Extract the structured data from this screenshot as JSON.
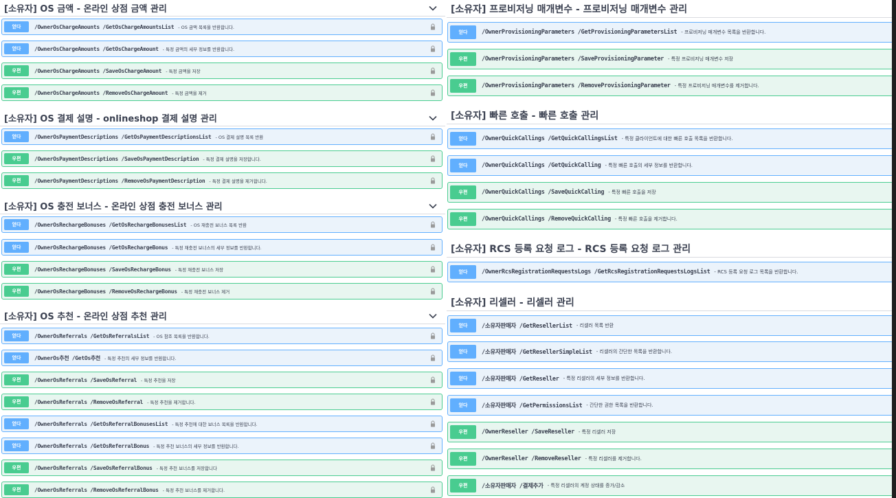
{
  "left": {
    "sections": [
      {
        "title": "[소유자] OS 금액 - 온라인 상점 금액 관리",
        "operations": [
          {
            "method": "GET",
            "method_label": "얻다",
            "path": "/OwnerOsChargeAmounts /GetOsChargeAmountsList",
            "desc": "- OS 금액 목록을 반환합니다."
          },
          {
            "method": "GET",
            "method_label": "얻다",
            "path": "/OwnerOsChargeAmounts /GetOsChargeAmount",
            "desc": "- 특정 금액의 세부 정보를 반환합니다."
          },
          {
            "method": "POST",
            "method_label": "우편",
            "path": "/OwnerOsChargeAmounts /SaveOsChargeAmount",
            "desc": "- 특정 금액을 저장"
          },
          {
            "method": "POST",
            "method_label": "우편",
            "path": "/OwnerOsChargeAmounts /RemoveOsChargeAmount",
            "desc": "- 특정 금액을 제거"
          }
        ]
      },
      {
        "title": "[소유자] OS 결제 설명 - onlineshop 결제 설명 관리",
        "operations": [
          {
            "method": "GET",
            "method_label": "얻다",
            "path": "/OwnerOsPaymentDescriptions /GetOsPaymentDescriptionsList",
            "desc": "- OS 결제 설명 목록 반환"
          },
          {
            "method": "POST",
            "method_label": "우편",
            "path": "/OwnerOsPaymentDescriptions /SaveOsPaymentDescription",
            "desc": "- 특정 결제 설명을 저장합니다."
          },
          {
            "method": "POST",
            "method_label": "우편",
            "path": "/OwnerOsPaymentDescriptions /RemoveOsPaymentDescription",
            "desc": "- 특정 결제 설명을 제거합니다."
          }
        ]
      },
      {
        "title": "[소유자] OS 충전 보너스 - 온라인 상점 충전 보너스 관리",
        "operations": [
          {
            "method": "GET",
            "method_label": "얻다",
            "path": "/OwnerOsRechargeBonuses /GetOsRechargeBonusesList",
            "desc": "- OS 재충전 보너스 목록 반환"
          },
          {
            "method": "GET",
            "method_label": "얻다",
            "path": "/OwnerOsRechargeBonuses /GetOsRechargeBonus",
            "desc": "- 특정 재충전 보너스의 세부 정보를 반환합니다."
          },
          {
            "method": "POST",
            "method_label": "우편",
            "path": "/OwnerOsRechargeBonuses /SaveOsRechargeBonus",
            "desc": "- 특정 재충전 보너스 저장"
          },
          {
            "method": "POST",
            "method_label": "우편",
            "path": "/OwnerOsRechargeBonuses /RemoveOsRechargeBonus",
            "desc": "- 특정 재충전 보너스 제거"
          }
        ]
      },
      {
        "title": "[소유자] OS 추천 - 온라인 상점 추천 관리",
        "operations": [
          {
            "method": "GET",
            "method_label": "얻다",
            "path": "/OwnerOsReferrals /GetOsReferralsList",
            "desc": "- OS 참조 목록을 반환합니다."
          },
          {
            "method": "GET",
            "method_label": "얻다",
            "path": "/OwnerOs추천 /GetOs추천",
            "desc": "- 특정 추천의 세부 정보를 반환합니다."
          },
          {
            "method": "POST",
            "method_label": "우편",
            "path": "/OwnerOsReferrals /SaveOsReferral",
            "desc": "- 특정 추천을 저장"
          },
          {
            "method": "POST",
            "method_label": "우편",
            "path": "/OwnerOsReferrals /RemoveOsReferral",
            "desc": "- 특정 추천을 제거합니다."
          },
          {
            "method": "GET",
            "method_label": "얻다",
            "path": "/OwnerOsReferrals /GetOsReferralBonusesList",
            "desc": "- 특정 추천에 대한 보너스 목록을 반환합니다."
          },
          {
            "method": "GET",
            "method_label": "얻다",
            "path": "/OwnerOsReferrals /GetOsReferralBonus",
            "desc": "- 특정 추천 보너스의 세부 정보를 반환합니다."
          },
          {
            "method": "POST",
            "method_label": "우편",
            "path": "/OwnerOsReferrals /SaveOsReferralBonus",
            "desc": "- 특정 추천 보너스를 저장합니다"
          },
          {
            "method": "POST",
            "method_label": "우편",
            "path": "/OwnerOsReferrals /RemoveOsReferralBonus",
            "desc": "- 특정 추천 보너스를 제거합니다."
          }
        ]
      }
    ]
  },
  "right": {
    "sections": [
      {
        "title": "[소유자] 프로비저닝 매개변수 - 프로비저닝 매개변수 관리",
        "operations": [
          {
            "method": "GET",
            "method_label": "얻다",
            "path": "/OwnerProvisioningParameters /GetProvisioningParametersList",
            "desc": "- 프로비저닝 매개변수 목록을 반환합니다."
          },
          {
            "method": "POST",
            "method_label": "우편",
            "path": "/OwnerProvisioningParameters /SaveProvisioningParameter",
            "desc": "- 특정 프로비저닝 매개변수 저장"
          },
          {
            "method": "POST",
            "method_label": "우편",
            "path": "/OwnerProvisioningParameters /RemoveProvisioningParameter",
            "desc": "- 특정 프로비저닝 매개변수를 제거합니다."
          }
        ]
      },
      {
        "title": "[소유자] 빠른 호출 - 빠른 호출 관리",
        "operations": [
          {
            "method": "GET",
            "method_label": "얻다",
            "path": "/OwnerQuickCallings /GetQuickCallingsList",
            "desc": "- 특정 클라이언트에 대한 빠른 호출 목록을 반환합니다."
          },
          {
            "method": "GET",
            "method_label": "얻다",
            "path": "/OwnerQuickCallings /GetQuickCalling",
            "desc": "- 특정 빠른 호출의 세부 정보를 반환합니다."
          },
          {
            "method": "POST",
            "method_label": "우편",
            "path": "/OwnerQuickCallings /SaveQuickCalling",
            "desc": "- 특정 빠른 호출을 저장"
          },
          {
            "method": "POST",
            "method_label": "우편",
            "path": "/OwnerQuickCallings /RemoveQuickCalling",
            "desc": "- 특정 빠른 호출을 제거합니다."
          }
        ]
      },
      {
        "title": "[소유자] RCS 등록 요청 로그 - RCS 등록 요청 로그 관리",
        "operations": [
          {
            "method": "GET",
            "method_label": "얻다",
            "path": "/OwnerRcsRegistrationRequestsLogs /GetRcsRegistrationRequestsLogsList",
            "desc": "- RCS 등록 요청 로그 목록을 반환합니다."
          }
        ]
      },
      {
        "title": "[소유자] 리셀러 - 리셀러 관리",
        "operations": [
          {
            "method": "GET",
            "method_label": "얻다",
            "path": "/소유자판매자 /GetResellerList",
            "desc": "- 리셀러 목록 반환"
          },
          {
            "method": "GET",
            "method_label": "얻다",
            "path": "/소유자판매자 /GetResellerSimpleList",
            "desc": "- 리셀러의 간단한 목록을 반환합니다."
          },
          {
            "method": "GET",
            "method_label": "얻다",
            "path": "/소유자판매자 /GetReseller",
            "desc": "- 특정 리셀러의 세부 정보를 반환합니다."
          },
          {
            "method": "GET",
            "method_label": "얻다",
            "path": "/소유자판매자 /GetPermissionsList",
            "desc": "- 간단한 권한 목록을 반환합니다."
          },
          {
            "method": "POST",
            "method_label": "우편",
            "path": "/OwnerReseller /SaveReseller",
            "desc": "- 특정 리셀러 저장"
          },
          {
            "method": "POST",
            "method_label": "우편",
            "path": "/OwnerReseller /RemoveReseller",
            "desc": "- 특정 리셀러를 제거합니다."
          },
          {
            "method": "POST",
            "method_label": "우편",
            "path": "/소유자판매자 /결제추가",
            "desc": "- 특정 리셀러의 계정 상태를 증가/감소"
          }
        ]
      }
    ]
  },
  "colors": {
    "get_accent": "#61affe",
    "get_bg": "#ebf3fb",
    "post_accent": "#49cc90",
    "post_bg": "#e8f6f0",
    "text": "#3b4151"
  },
  "icons": {
    "section_toggle": "chevron-down-icon",
    "operation_auth": "lock-icon"
  }
}
